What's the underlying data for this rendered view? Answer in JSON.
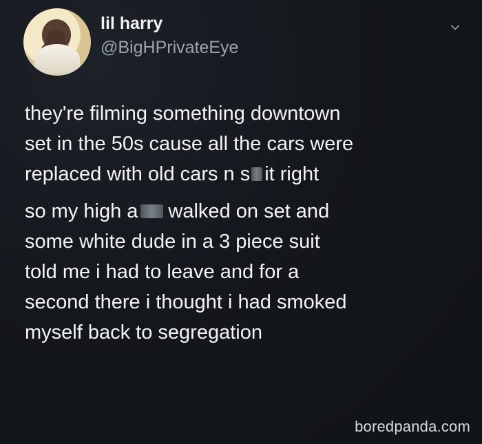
{
  "tweet": {
    "user": {
      "display_name": "lil harry",
      "handle": "@BigHPrivateEye"
    },
    "menu_icon": "chevron-down-icon",
    "body": {
      "lines": [
        {
          "text": "they're filming something downtown"
        },
        {
          "text": "set in the 50s cause all the cars were"
        },
        {
          "segments": [
            "replaced with old cars n s",
            "it right"
          ]
        },
        {
          "segments": [
            "so my high a",
            "walked on set and"
          ]
        },
        {
          "text": "some white dude in a 3 piece suit"
        },
        {
          "text": "told me i had to leave and for a"
        },
        {
          "text": "second there i thought i had smoked"
        },
        {
          "text": "myself back to segregation"
        }
      ]
    }
  },
  "watermark": "boredpanda.com"
}
